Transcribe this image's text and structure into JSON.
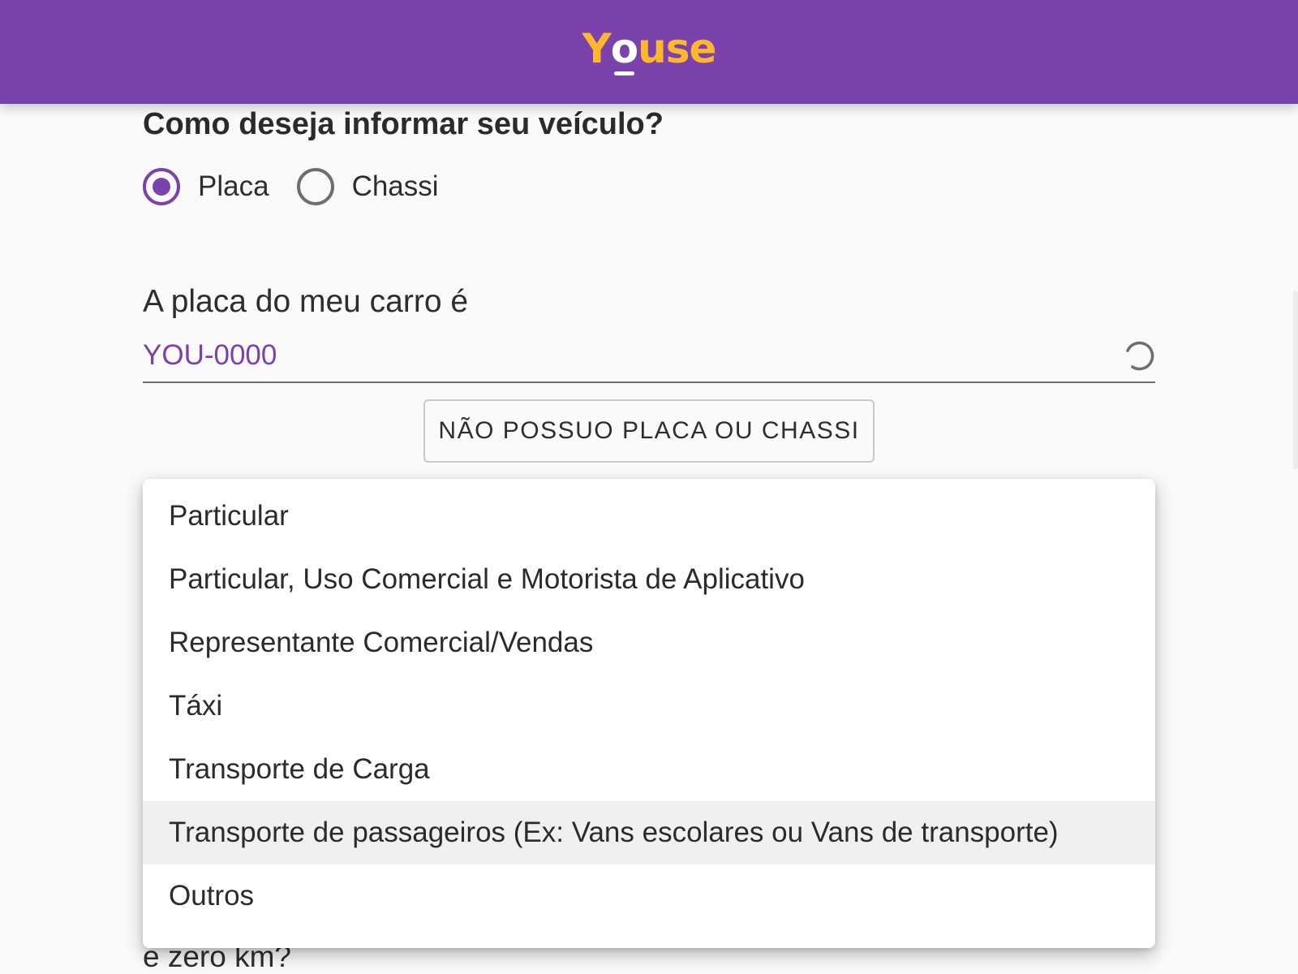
{
  "header": {
    "logo_parts": [
      "Y",
      "o",
      "use"
    ],
    "brand_color": "#7b42ab",
    "logo_color": "#ffb82e"
  },
  "vehicle_form": {
    "question": "Como deseja informar seu veículo?",
    "options": [
      {
        "label": "Placa",
        "selected": true
      },
      {
        "label": "Chassi",
        "selected": false
      }
    ],
    "plate_label": "A placa do meu carro é",
    "plate_value": "YOU-0000",
    "no_plate_button": "NÃO POSSUO PLACA OU CHASSI",
    "partial_question_text": "e zero km?"
  },
  "usage_dropdown": {
    "items": [
      "Particular",
      "Particular, Uso Comercial e Motorista de Aplicativo",
      "Representante Comercial/Vendas",
      "Táxi",
      "Transporte de Carga",
      "Transporte de passageiros (Ex: Vans escolares ou Vans de transporte)",
      "Outros"
    ],
    "hovered_item": "Transporte de passageiros (Ex: Vans escolares ou Vans de transporte)"
  },
  "icons": {
    "spinner": "loading-spinner-icon"
  }
}
